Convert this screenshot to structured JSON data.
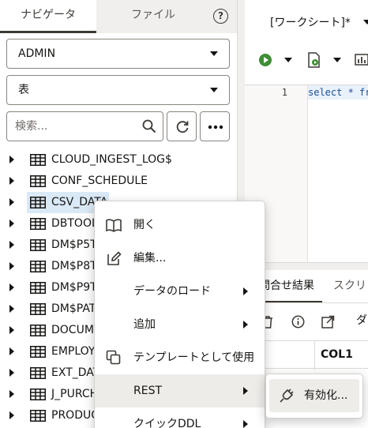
{
  "navigator": {
    "tabs": [
      {
        "label": "ナビゲータ",
        "active": true
      },
      {
        "label": "ファイル",
        "active": false
      }
    ],
    "help_label": "?",
    "schema_select": {
      "value": "ADMIN"
    },
    "object_type_select": {
      "value": "表"
    },
    "search": {
      "placeholder": "検索...",
      "value": ""
    },
    "tree": [
      {
        "label": "CLOUD_INGEST_LOG$",
        "icon": "table-icon",
        "selected": false
      },
      {
        "label": "CONF_SCHEDULE",
        "icon": "table-icon",
        "selected": false
      },
      {
        "label": "CSV_DATA",
        "icon": "table-icon",
        "selected": true
      },
      {
        "label": "DBTOOL",
        "icon": "table-icon",
        "selected": false
      },
      {
        "label": "DM$P5T",
        "icon": "table-icon",
        "selected": false
      },
      {
        "label": "DM$P8T",
        "icon": "table-icon",
        "selected": false
      },
      {
        "label": "DM$P9T",
        "icon": "table-icon",
        "selected": false
      },
      {
        "label": "DM$PAT",
        "icon": "table-icon",
        "selected": false
      },
      {
        "label": "DOCUMI",
        "icon": "table-icon",
        "selected": false
      },
      {
        "label": "EMPLOY",
        "icon": "table-icon",
        "selected": false
      },
      {
        "label": "EXT_DAT",
        "icon": "table-icon",
        "selected": false
      },
      {
        "label": "J_PURCH",
        "icon": "table-icon",
        "selected": false
      },
      {
        "label": "PRODUC",
        "icon": "table-icon",
        "selected": false
      }
    ]
  },
  "worksheet": {
    "title": "[ワークシート]*",
    "line_number": "1",
    "code": "select * fr",
    "result_tabs": [
      {
        "label": "問合せ結果",
        "active": true
      },
      {
        "label": "スクリ",
        "active": false
      }
    ],
    "toolbar_text": "ダ",
    "grid_header": "COL1"
  },
  "context_menu": {
    "items": [
      {
        "label": "開く",
        "icon": "book-icon",
        "submenu": false,
        "hover": false
      },
      {
        "label": "編集...",
        "icon": "edit-icon",
        "submenu": false,
        "hover": false
      },
      {
        "label": "データのロード",
        "icon": "",
        "submenu": true,
        "hover": false
      },
      {
        "label": "追加",
        "icon": "",
        "submenu": true,
        "hover": false
      },
      {
        "label": "テンプレートとして使用",
        "icon": "copy-icon",
        "submenu": false,
        "hover": false
      },
      {
        "label": "REST",
        "icon": "",
        "submenu": true,
        "hover": true
      },
      {
        "label": "クイックDDL",
        "icon": "",
        "submenu": true,
        "hover": false
      }
    ],
    "rest_submenu": {
      "label": "有効化...",
      "icon": "plug-icon"
    }
  },
  "colors": {
    "selection": "#dae9f6",
    "menu_hover": "#eeece9",
    "run_green": "#3f8e36",
    "panel_bg": "#f1efed"
  }
}
